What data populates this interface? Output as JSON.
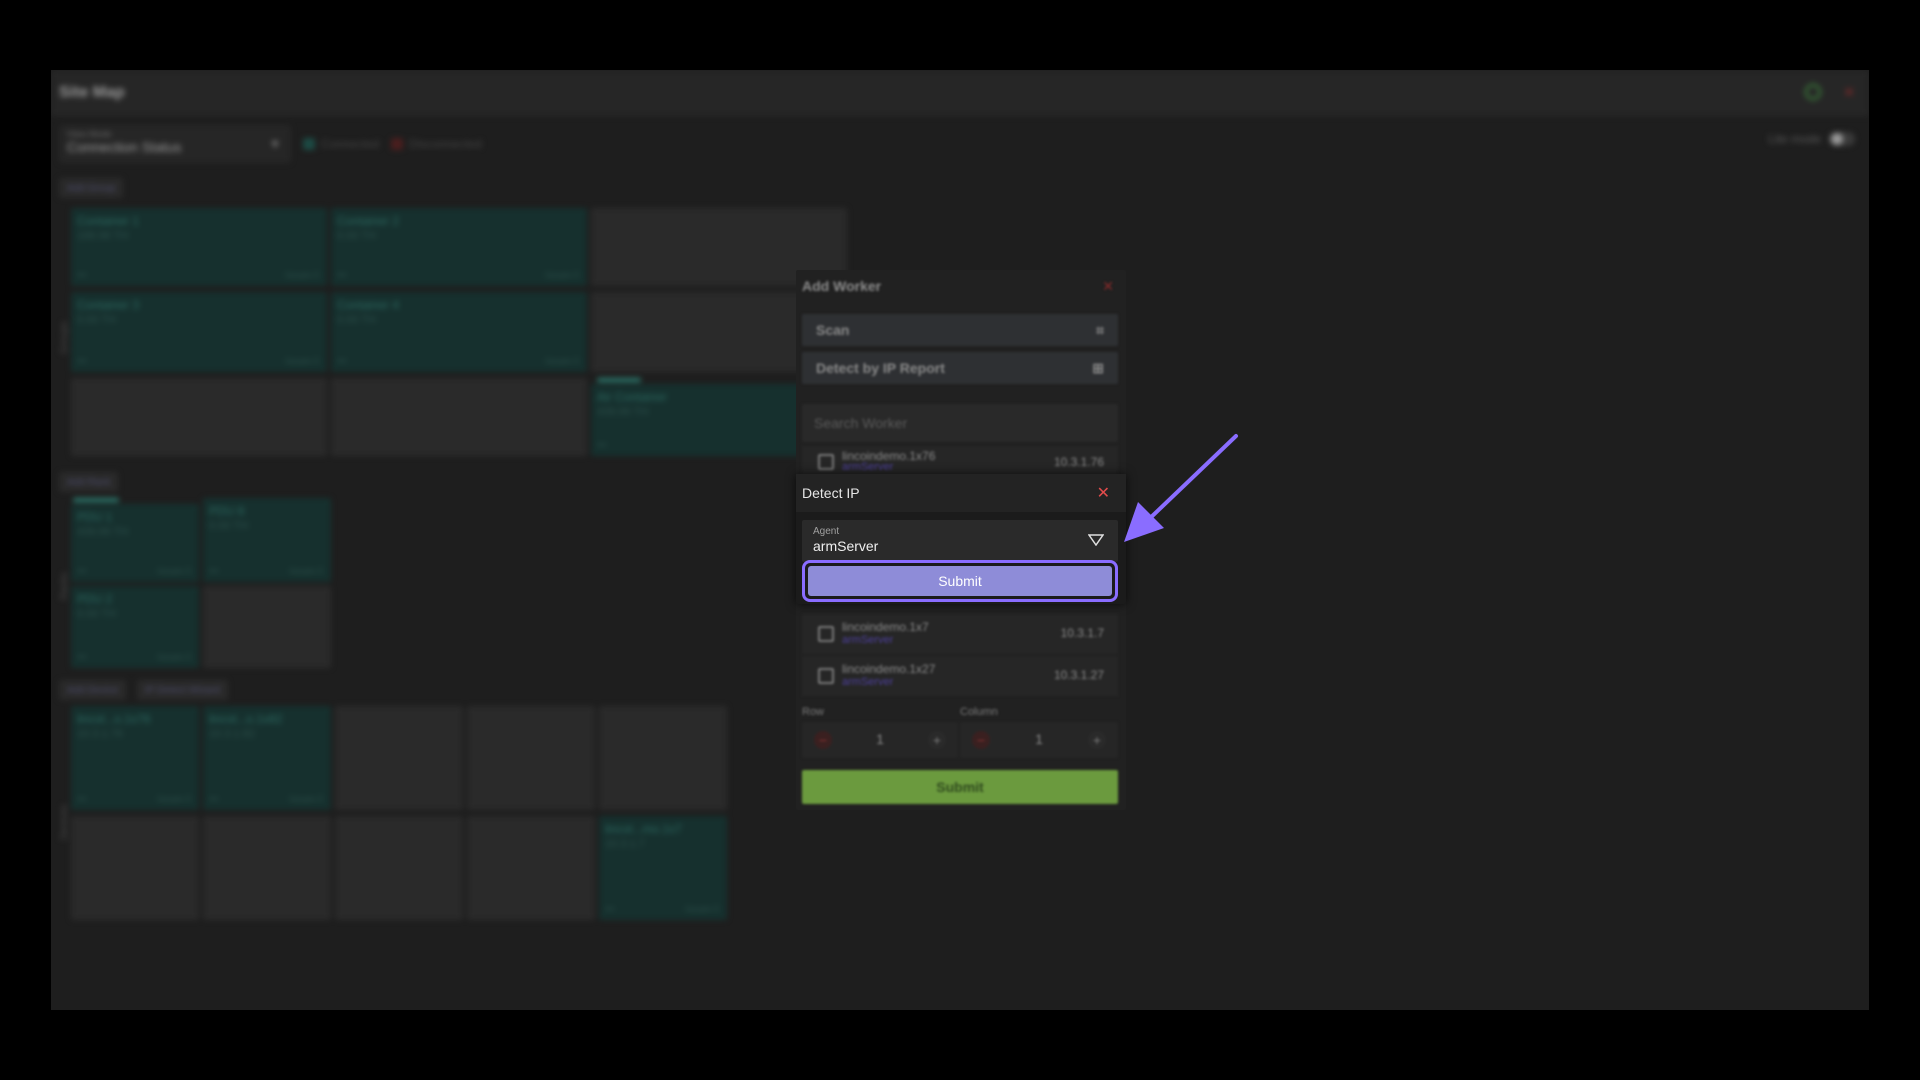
{
  "window": {
    "title": "Site Map"
  },
  "toolbar": {
    "view_mode_label": "View Mode",
    "view_mode_value": "Connection Status",
    "legend_connected": "Connected",
    "legend_disconnected": "Disconnected",
    "lite_mode_label": "Lite mode"
  },
  "colors": {
    "connected": "#1d4a44",
    "disconnected": "#4a1f1f",
    "accent": "#8a6dff",
    "submit_green": "#6b9a3e"
  },
  "sections": {
    "groups": {
      "add_label": "Add Group",
      "side_label": "Groups",
      "cells": [
        {
          "name": "Container 1",
          "sub": "188.98 TH",
          "issues": "Issues 0"
        },
        {
          "name": "Container 2",
          "sub": "0.00 TH",
          "issues": "Issues 0"
        },
        {
          "name": "Container 3",
          "sub": "0.00 TH",
          "issues": "Issues 0"
        },
        {
          "name": "Container 4",
          "sub": "0.00 TH",
          "issues": "Issues 0"
        },
        {
          "name": "Air Container",
          "sub": "439.99 TH",
          "issues": ""
        }
      ]
    },
    "racks": {
      "add_label": "Add Rack",
      "side_label": "Racks",
      "cells": [
        {
          "name": "PDU 1",
          "sub": "439.99 TH",
          "issues": "Issues 0"
        },
        {
          "name": "PDU 8",
          "sub": "0.00 TH",
          "issues": "Issues 0"
        },
        {
          "name": "PDU 2",
          "sub": "0.00 TH",
          "issues": "Issues 0"
        }
      ]
    },
    "devices": {
      "add_label": "Add Device",
      "detect_label": "IP Detect Wizard",
      "side_label": "Devices",
      "cells": [
        {
          "name": "lincol...o.1x76",
          "sub": "10.3.1.76",
          "issues": "Issues 0"
        },
        {
          "name": "lincol...o.1x82",
          "sub": "10.3.1.82",
          "issues": "Issues 0"
        },
        {
          "name": "lincol...mo.1x7",
          "sub": "10.3.1.7",
          "issues": "Issues 0"
        }
      ]
    }
  },
  "add_worker": {
    "title": "Add Worker",
    "scan_label": "Scan",
    "detect_report_label": "Detect by IP Report",
    "search_placeholder": "Search Worker",
    "workers": [
      {
        "name": "lincoindemo.1x76",
        "server": "armServer",
        "ip": "10.3.1.76"
      },
      {
        "name": "lincoindemo.1x7",
        "server": "armServer",
        "ip": "10.3.1.7"
      },
      {
        "name": "lincoindemo.1x27",
        "server": "armServer",
        "ip": "10.3.1.27"
      }
    ],
    "row_label": "Row",
    "row_value": "1",
    "column_label": "Column",
    "column_value": "1",
    "submit_label": "Submit"
  },
  "detect_ip": {
    "title": "Detect IP",
    "agent_label": "Agent",
    "agent_value": "armServer",
    "submit_label": "Submit"
  }
}
